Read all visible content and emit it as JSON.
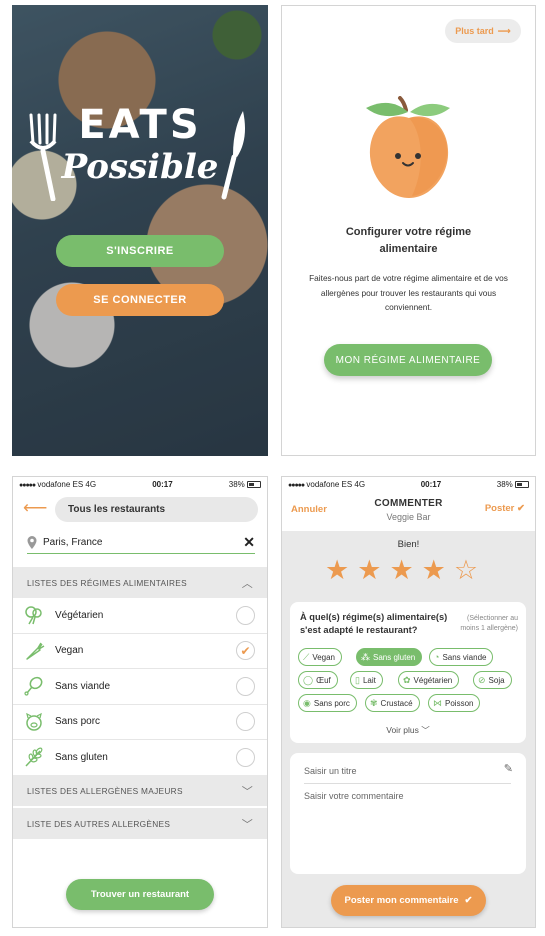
{
  "welcome": {
    "logo_line1": "EATS",
    "logo_line2": "Possible",
    "signup_label": "S'INSCRIRE",
    "login_label": "SE CONNECTER",
    "colors": {
      "green": "#79bd6c",
      "orange": "#ec9a4f"
    }
  },
  "onboarding": {
    "later_label": "Plus tard",
    "later_icon": "arrow-right-icon",
    "title": "Configurer votre régime alimentaire",
    "description": "Faites-nous part de votre régime alimentaire et de vos allergènes pour trouver les restaurants qui vous conviennent.",
    "button_label": "MON RÉGIME ALIMENTAIRE",
    "illustration": "peach-mascot-icon"
  },
  "status_bar": {
    "carrier": "vodafone ES",
    "network": "4G",
    "time": "00:17",
    "battery": "38%"
  },
  "filters": {
    "back_icon": "arrow-left-icon",
    "scope_label": "Tous les restaurants",
    "location_value": "Paris, France",
    "clear_icon": "close-icon",
    "diet_section": "LISTES DES RÉGIMES ALIMENTAIRES",
    "diets": [
      {
        "label": "Végétarien",
        "icon": "broccoli-icon",
        "checked": false
      },
      {
        "label": "Vegan",
        "icon": "carrot-icon",
        "checked": true
      },
      {
        "label": "Sans viande",
        "icon": "drumstick-icon",
        "checked": false
      },
      {
        "label": "Sans porc",
        "icon": "pig-icon",
        "checked": false
      },
      {
        "label": "Sans gluten",
        "icon": "wheat-icon",
        "checked": false
      }
    ],
    "major_allergens_section": "LISTES DES ALLERGÈNES MAJEURS",
    "other_allergens_section": "LISTE DES AUTRES ALLERGÈNES",
    "find_button": "Trouver un restaurant"
  },
  "comment": {
    "cancel_label": "Annuler",
    "title": "COMMENTER",
    "restaurant": "Veggie Bar",
    "post_label": "Poster",
    "rating_text": "Bien!",
    "rating": 4,
    "rating_max": 5,
    "question": "À quel(s) régime(s) alimentaire(s) s'est adapté le restaurant?",
    "question_hint": "(Sélectionner au moins 1 allergène)",
    "chips": [
      {
        "label": "Vegan",
        "selected": false
      },
      {
        "label": "Sans gluten",
        "selected": true
      },
      {
        "label": "Sans viande",
        "selected": false
      },
      {
        "label": "Œuf",
        "selected": false
      },
      {
        "label": "Lait",
        "selected": false
      },
      {
        "label": "Végétarien",
        "selected": false
      },
      {
        "label": "Soja",
        "selected": false
      },
      {
        "label": "Sans porc",
        "selected": false
      },
      {
        "label": "Crustacé",
        "selected": false
      },
      {
        "label": "Poisson",
        "selected": false
      }
    ],
    "see_more": "Voir plus",
    "title_placeholder": "Saisir un titre",
    "comment_placeholder": "Saisir votre commentaire",
    "post_button": "Poster mon commentaire"
  }
}
